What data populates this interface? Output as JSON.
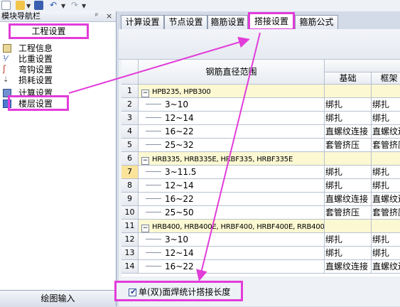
{
  "navigator": {
    "title": "模块导航栏",
    "pin": "ᵖ",
    "close": "×",
    "section": "工程设置",
    "items": [
      {
        "label": "工程信息",
        "icon": "project-info-icon"
      },
      {
        "label": "比重设置",
        "icon": "weight-icon"
      },
      {
        "label": "弯钩设置",
        "icon": "hook-icon"
      },
      {
        "label": "损耗设置",
        "icon": "loss-icon"
      },
      {
        "label": "计算设置",
        "icon": "calc-icon"
      },
      {
        "label": "楼层设置",
        "icon": "floor-icon"
      }
    ],
    "footer": "绘图输入"
  },
  "tabs": [
    "计算设置",
    "节点设置",
    "箍筋设置",
    "搭接设置",
    "箍筋公式"
  ],
  "active_tab": "搭接设置",
  "table": {
    "header_range": "钢筋直径范围",
    "col1": "基础",
    "col2": "框架",
    "rows": [
      {
        "num": "1",
        "group": true,
        "range": "HPB235, HPB300",
        "c1": "",
        "c2": ""
      },
      {
        "num": "2",
        "group": false,
        "range": "3~10",
        "c1": "绑扎",
        "c2": "绑扎"
      },
      {
        "num": "3",
        "group": false,
        "range": "12~14",
        "c1": "绑扎",
        "c2": "绑扎"
      },
      {
        "num": "4",
        "group": false,
        "range": "16~22",
        "c1": "直螺纹连接",
        "c2": "直螺纹连"
      },
      {
        "num": "5",
        "group": false,
        "range": "25~32",
        "c1": "套管挤压",
        "c2": "套管挤压"
      },
      {
        "num": "6",
        "group": true,
        "range": "HRB335, HRB335E, HRBF335, HRBF335E",
        "c1": "",
        "c2": ""
      },
      {
        "num": "7",
        "group": false,
        "range": "3~11.5",
        "c1": "绑扎",
        "c2": "绑扎"
      },
      {
        "num": "8",
        "group": false,
        "range": "12~14",
        "c1": "绑扎",
        "c2": "绑扎"
      },
      {
        "num": "9",
        "group": false,
        "range": "16~22",
        "c1": "直螺纹连接",
        "c2": "直螺纹连"
      },
      {
        "num": "10",
        "group": false,
        "range": "25~50",
        "c1": "套管挤压",
        "c2": "套管挤压"
      },
      {
        "num": "11",
        "group": true,
        "range": "HRB400, HRB400E, HRBF400, HRBF400E, RRB400,",
        "c1": "",
        "c2": ""
      },
      {
        "num": "12",
        "group": false,
        "range": "3~10",
        "c1": "绑扎",
        "c2": "绑扎"
      },
      {
        "num": "13",
        "group": false,
        "range": "12~14",
        "c1": "绑扎",
        "c2": "绑扎"
      },
      {
        "num": "14",
        "group": false,
        "range": "16~22",
        "c1": "直螺纹连接",
        "c2": "直螺纹连"
      }
    ]
  },
  "checkbox": {
    "label": "单(双)面焊统计搭接长度",
    "checked": true
  },
  "colors": {
    "highlight": "#e23cd9",
    "group_row": "#fbf8d2",
    "selected_row_num": "#fbe39a"
  }
}
